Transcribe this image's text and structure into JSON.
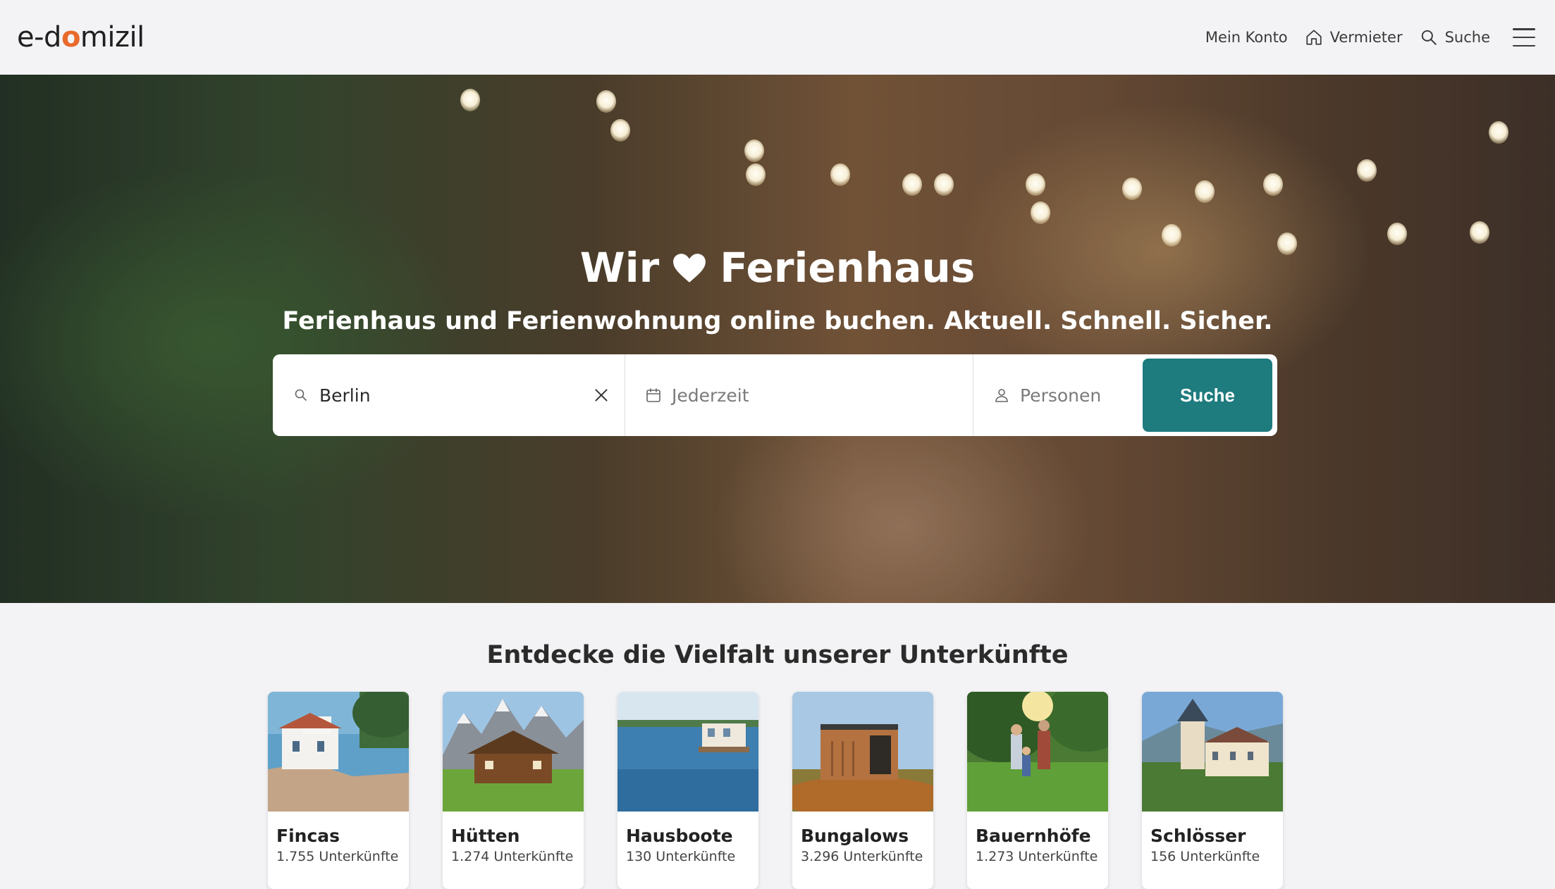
{
  "header": {
    "logo": {
      "part1": "e-d",
      "part2": "o",
      "part3": "mizil"
    },
    "nav": [
      {
        "label": "Mein Konto",
        "icon": null
      },
      {
        "label": "Vermieter",
        "icon": "home-icon"
      },
      {
        "label": "Suche",
        "icon": "search-icon"
      }
    ],
    "menu_icon": "hamburger-menu-icon"
  },
  "hero": {
    "title_before": "Wir",
    "title_icon": "heart-icon",
    "title_after": "Ferienhaus",
    "subtitle": "Ferienhaus und Ferienwohnung online buchen. Aktuell. Schnell. Sicher."
  },
  "search": {
    "location_value": "Berlin",
    "date_placeholder": "Jederzeit",
    "persons_placeholder": "Personen",
    "button_label": "Suche"
  },
  "categories": {
    "title": "Entdecke die Vielfalt unserer Unterkünfte",
    "items": [
      {
        "name": "Fincas",
        "count": "1.755 Unterkünfte"
      },
      {
        "name": "Hütten",
        "count": "1.274 Unterkünfte"
      },
      {
        "name": "Hausboote",
        "count": "130 Unterkünfte"
      },
      {
        "name": "Bungalows",
        "count": "3.296 Unterkünfte"
      },
      {
        "name": "Bauernhöfe",
        "count": "1.273 Unterkünfte"
      },
      {
        "name": "Schlösser",
        "count": "156 Unterkünfte"
      }
    ]
  },
  "colors": {
    "accent": "#1e7b7e",
    "logo_accent": "#e96a2c",
    "background": "#f3f3f5"
  }
}
